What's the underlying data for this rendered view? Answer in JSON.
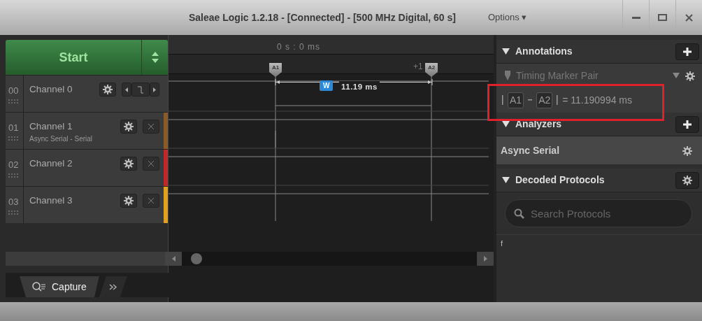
{
  "window": {
    "title": "Saleae Logic 1.2.18 - [Connected] - [500 MHz Digital, 60 s]",
    "options": "Options ▾"
  },
  "start_button": {
    "label": "Start"
  },
  "channels": [
    {
      "index": "00",
      "name": "Channel 0",
      "kind": "trigger"
    },
    {
      "index": "01",
      "name": "Channel 1",
      "subtitle": "Async Serial - Serial",
      "kind": "close",
      "color": "#8a5a2b"
    },
    {
      "index": "02",
      "name": "Channel 2",
      "kind": "close",
      "color": "#c0282a"
    },
    {
      "index": "03",
      "name": "Channel 3",
      "kind": "close",
      "color": "#e0a020"
    }
  ],
  "timeline": {
    "time_label": "0 s : 0 ms",
    "tick_label": "+1",
    "markers": [
      "A1",
      "A2"
    ],
    "width_tag": "W",
    "width_value": "11.19 ms"
  },
  "annotations": {
    "title": "Annotations",
    "item": "Timing Marker Pair",
    "measurement": {
      "marker_a": "A1",
      "marker_b": "A2",
      "value": "= 11.190994 ms"
    }
  },
  "analyzers": {
    "title": "Analyzers",
    "items": [
      "Async Serial"
    ]
  },
  "decoded_protocols": {
    "title": "Decoded Protocols",
    "search_placeholder": "Search Protocols",
    "output": "f"
  },
  "tabs": [
    {
      "label": "Capture",
      "selected": true
    }
  ]
}
